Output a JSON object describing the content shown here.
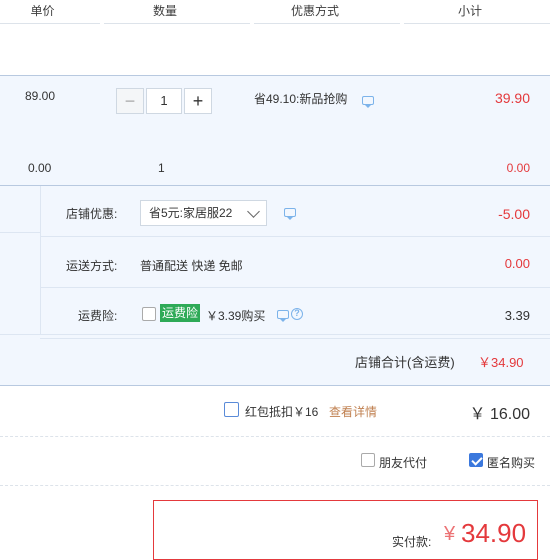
{
  "header": {
    "col_price": "单价",
    "col_qty": "数量",
    "col_promo": "优惠方式",
    "col_subtotal": "小计"
  },
  "item": {
    "price": "89.00",
    "qty": "1",
    "promo": "省49.10:新品抢购",
    "subtotal": "39.90"
  },
  "gift": {
    "price": "0.00",
    "qty": "1",
    "subtotal": "0.00"
  },
  "store": {
    "discount_label": "店铺优惠:",
    "discount_selected": "省5元:家居服22",
    "discount_amount": "-5.00",
    "shipping_label": "运送方式:",
    "shipping_value": "普通配送 快递 免邮",
    "shipping_amount": "0.00",
    "insurance_label": "运费险:",
    "insurance_tag": "运费险",
    "insurance_text": "￥3.39购买",
    "insurance_amount": "3.39",
    "total_label": "店铺合计(含运费)",
    "total_amount": "￥34.90"
  },
  "redpacket": {
    "label": "红包抵扣￥16",
    "link": "查看详情",
    "amount": "￥ 16.00"
  },
  "options": {
    "friend_pay": "朋友代付",
    "anonymous": "匿名购买"
  },
  "payment": {
    "label": "实付款:",
    "currency": "¥",
    "amount": "34.90"
  },
  "colors": {
    "accent_red": "#e4393c",
    "band_blue": "#f2f7fe",
    "check_blue": "#3b78dd",
    "tag_green": "#2eaa57",
    "link_orange": "#c08050"
  }
}
